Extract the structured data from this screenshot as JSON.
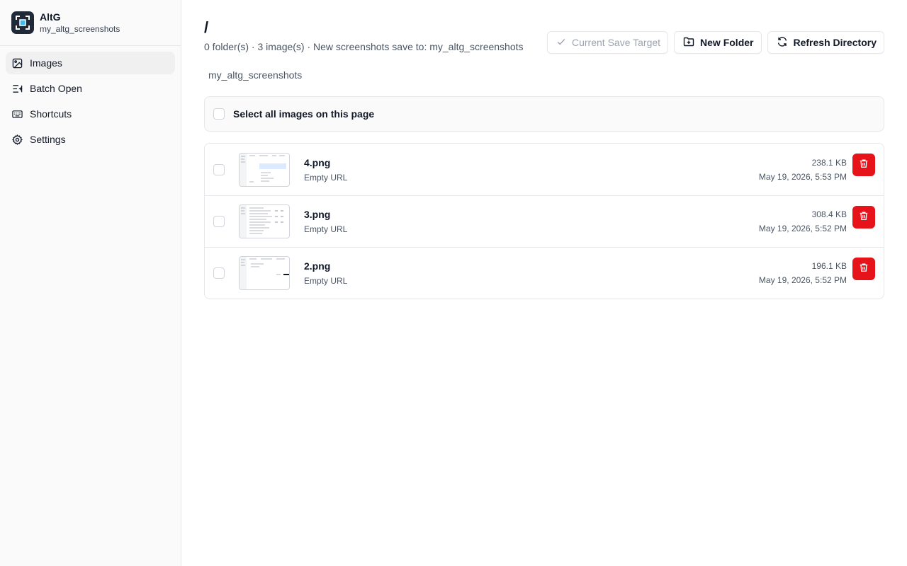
{
  "app": {
    "name": "AltG",
    "subtitle": "my_altg_screenshots"
  },
  "sidebar": {
    "items": [
      {
        "label": "Images",
        "icon": "image-icon",
        "active": true
      },
      {
        "label": "Batch Open",
        "icon": "batch-open-icon",
        "active": false
      },
      {
        "label": "Shortcuts",
        "icon": "keyboard-icon",
        "active": false
      },
      {
        "label": "Settings",
        "icon": "gear-icon",
        "active": false
      }
    ]
  },
  "header": {
    "title": "/",
    "meta": "0 folder(s) · 3 image(s) · New screenshots save to: my_altg_screenshots",
    "breadcrumb": "my_altg_screenshots"
  },
  "toolbar": {
    "current_save_target": "Current Save Target",
    "new_folder": "New Folder",
    "refresh_directory": "Refresh Directory"
  },
  "select_all": {
    "label": "Select all images on this page",
    "checked": false
  },
  "files": [
    {
      "name": "4.png",
      "url": "Empty URL",
      "size": "238.1 KB",
      "date": "May 19, 2026, 5:53 PM"
    },
    {
      "name": "3.png",
      "url": "Empty URL",
      "size": "308.4 KB",
      "date": "May 19, 2026, 5:52 PM"
    },
    {
      "name": "2.png",
      "url": "Empty URL",
      "size": "196.1 KB",
      "date": "May 19, 2026, 5:52 PM"
    }
  ],
  "colors": {
    "accent_delete": "#e7131a",
    "app_icon_bg": "#1f2937",
    "app_icon_accent": "#38bdf8"
  }
}
